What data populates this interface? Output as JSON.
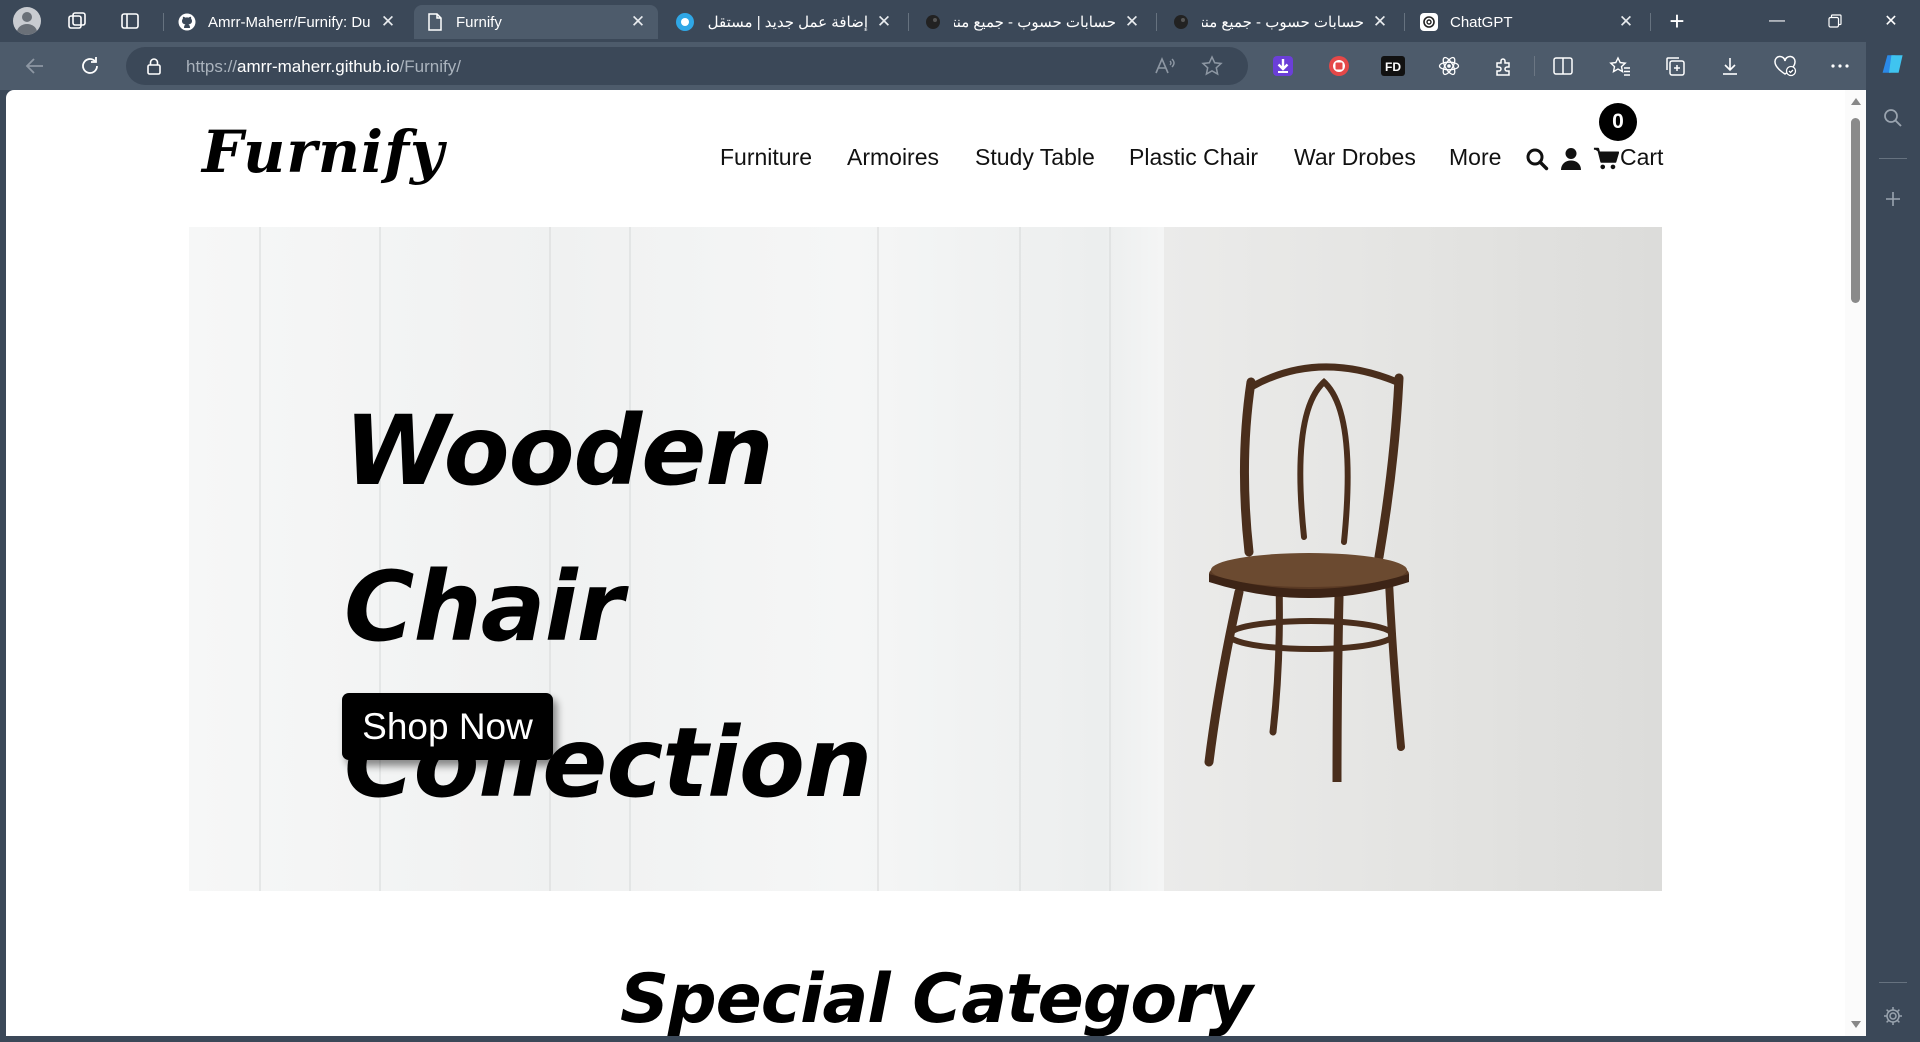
{
  "browser": {
    "tabs": [
      {
        "title": "Amrr-Maherr/Furnify: Du",
        "icon": "github-icon",
        "active": false
      },
      {
        "title": "Furnify",
        "icon": "page-icon",
        "active": true
      },
      {
        "title": "إضافة عمل جديد | مستقل",
        "icon": "mostaql-icon",
        "active": false
      },
      {
        "title": "حسابات حسوب - جميع منتـ",
        "icon": "hsoub-icon",
        "active": false
      },
      {
        "title": "حسابات حسوب - جميع منتـ",
        "icon": "hsoub-icon",
        "active": false
      },
      {
        "title": "ChatGPT",
        "icon": "chatgpt-icon",
        "active": false
      }
    ],
    "url": {
      "prefix": "https://",
      "host": "amrr-maherr.github.io",
      "path": "/Furnify/"
    }
  },
  "site": {
    "logo": "Furnify",
    "nav": [
      "Furniture",
      "Armoires",
      "Study Table",
      "Plastic Chair",
      "War Drobes",
      "More"
    ],
    "cart_label": "Cart",
    "cart_count": "0",
    "hero": {
      "title_line1": "Wooden Chair",
      "title_line2": "Collection",
      "button": "Shop Now"
    },
    "section_title": "Special Category"
  },
  "colors": {
    "browser_chrome": "#3b4858",
    "toolbar": "#4d5b6b",
    "button_bg": "#000000",
    "accent_text": "#111111"
  }
}
